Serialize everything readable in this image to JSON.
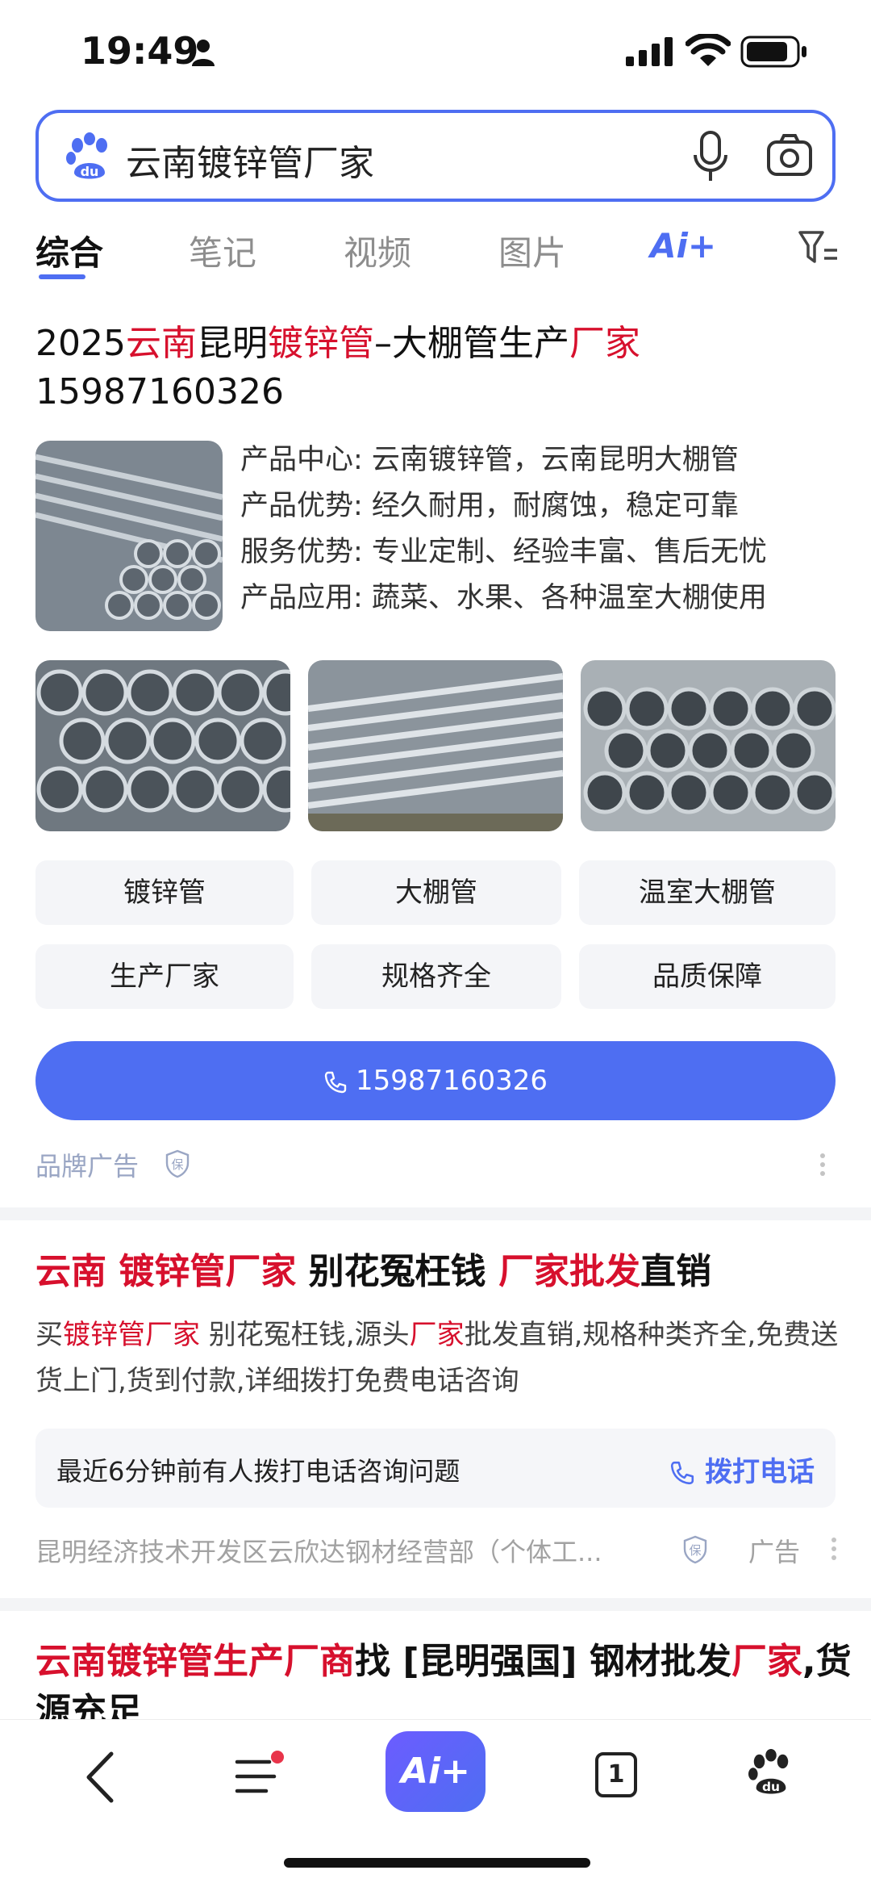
{
  "status_bar": {
    "time": "19:49"
  },
  "search": {
    "query": "云南镀锌管厂家"
  },
  "tabs": [
    {
      "label": "综合"
    },
    {
      "label": "笔记"
    },
    {
      "label": "视频"
    },
    {
      "label": "图片"
    }
  ],
  "tab_ai_label": "Ai+",
  "result1": {
    "title_parts": [
      "2025",
      "云南",
      "昆明",
      "镀锌管",
      "–大棚管生产",
      "厂家"
    ],
    "phone_line": "15987160326",
    "info": [
      "产品中心: 云南镀锌管，云南昆明大棚管",
      "产品优势: 经久耐用，耐腐蚀，稳定可靠",
      "服务优势: 专业定制、经验丰富、售后无忧",
      "产品应用: 蔬菜、水果、各种温室大棚使用"
    ],
    "chips": [
      "镀锌管",
      "大棚管",
      "温室大棚管",
      "生产厂家",
      "规格齐全",
      "品质保障"
    ],
    "call_button": "15987160326",
    "ad_label": "品牌广告"
  },
  "result2": {
    "title_parts": [
      "云南 镀锌管厂家",
      " 别花冤枉钱 ",
      "厂家批发",
      "直销"
    ],
    "desc_parts": [
      "买",
      "镀锌管厂家",
      " 别花冤枉钱,源头",
      "厂家",
      "批发直销,规格种类齐全,免费送货上门,货到付款,详细拨打免费电话咨询"
    ],
    "notice": "最近6分钟前有人拨打电话咨询问题",
    "notice_call": "拨打电话",
    "source": "昆明经济技术开发区云欣达钢材经营部（个体工...",
    "ad_label": "广告"
  },
  "result3": {
    "title_parts": [
      "云南镀锌管生产厂商",
      "找 [昆明强国] 钢材批发",
      "厂家",
      ",货源充足"
    ]
  },
  "bottom_bar": {
    "ai_label": "Ai+",
    "tab_count": "1"
  },
  "colors": {
    "accent": "#4e6ef2",
    "highlight": "#d7102d"
  }
}
